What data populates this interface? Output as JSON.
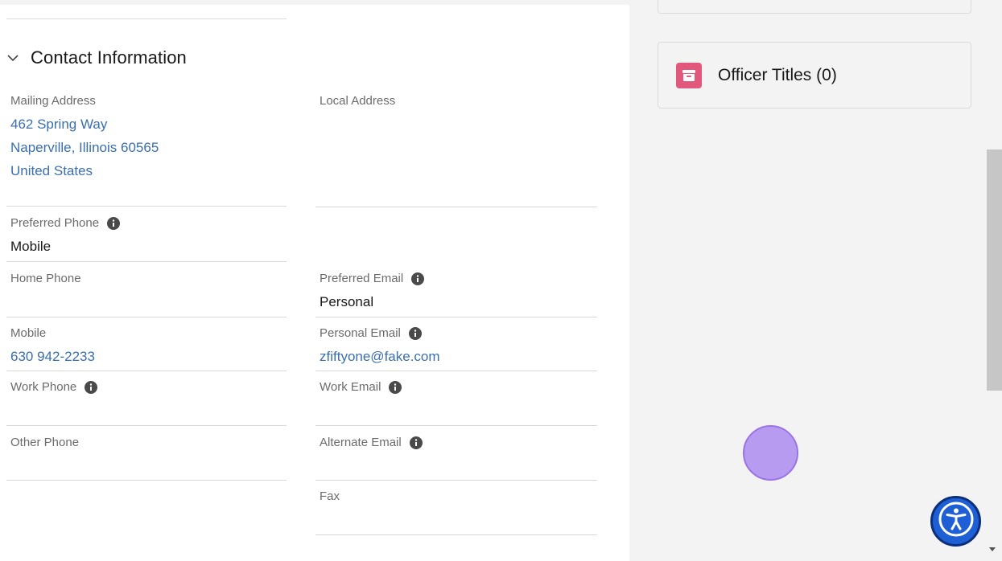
{
  "section": {
    "title": "Contact Information"
  },
  "fields": {
    "mailing_address": {
      "label": "Mailing Address",
      "lines": [
        "462 Spring Way",
        "Naperville, Illinois 60565",
        "United States"
      ]
    },
    "local_address": {
      "label": "Local Address",
      "value": ""
    },
    "preferred_phone": {
      "label": "Preferred Phone",
      "value": "Mobile"
    },
    "home_phone": {
      "label": "Home Phone",
      "value": ""
    },
    "preferred_email": {
      "label": "Preferred Email",
      "value": "Personal"
    },
    "mobile": {
      "label": "Mobile",
      "value": "630 942-2233"
    },
    "personal_email": {
      "label": "Personal Email",
      "value": "zfiftyone@fake.com"
    },
    "work_phone": {
      "label": "Work Phone",
      "value": ""
    },
    "work_email": {
      "label": "Work Email",
      "value": ""
    },
    "other_phone": {
      "label": "Other Phone",
      "value": ""
    },
    "alternate_email": {
      "label": "Alternate Email",
      "value": ""
    },
    "fax": {
      "label": "Fax",
      "value": ""
    }
  },
  "related": {
    "officer_titles": "Officer Titles (0)"
  },
  "icons": {
    "section_toggle": "chevron-down-icon",
    "info": "info-icon",
    "related_list": "archive-icon",
    "accessibility": "accessibility-icon"
  },
  "colors": {
    "link": "#3a6fb0",
    "related_icon_bg": "#e2577c",
    "accessibility_bg": "#1f5fd6",
    "cursor_highlight": "#b39af2"
  }
}
